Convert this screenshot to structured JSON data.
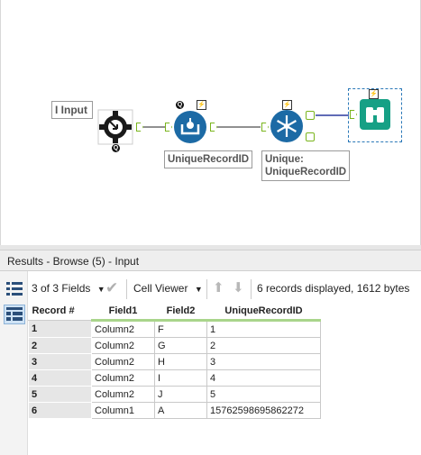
{
  "canvas": {
    "comments": {
      "input": "I Input",
      "unique_record_id": "UniqueRecordID",
      "unique_line1": "Unique:",
      "unique_line2": "UniqueRecordID"
    },
    "badges": {
      "q": "Q",
      "bolt": "⚡"
    }
  },
  "results": {
    "title": "Results - Browse (5) - Input",
    "toolbar": {
      "fields": "3 of 3 Fields",
      "viewer": "Cell Viewer",
      "summary": "6 records displayed, 1612 bytes"
    },
    "table": {
      "headers": [
        "Record #",
        "Field1",
        "Field2",
        "UniqueRecordID"
      ],
      "rows": [
        [
          "1",
          "Column2",
          "F",
          "1"
        ],
        [
          "2",
          "Column2",
          "G",
          "2"
        ],
        [
          "3",
          "Column2",
          "H",
          "3"
        ],
        [
          "4",
          "Column2",
          "I",
          "4"
        ],
        [
          "5",
          "Column2",
          "J",
          "5"
        ],
        [
          "6",
          "Column1",
          "A",
          "15762598695862272"
        ]
      ]
    }
  },
  "colors": {
    "accent_green": "#7ab51d",
    "tool_blue": "#1c6aa5",
    "browse_teal": "#16a085"
  }
}
